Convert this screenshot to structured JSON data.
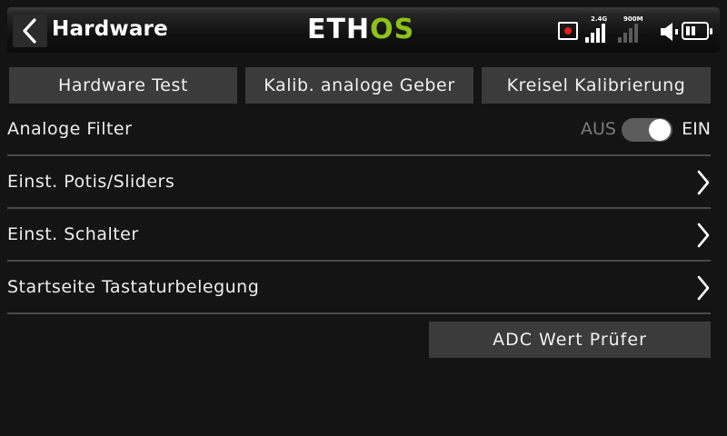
{
  "header": {
    "title": "Hardware",
    "logo": {
      "part1": "ETH",
      "part2": "OS"
    },
    "status": {
      "signal_a_label": "2.4G",
      "signal_b_label": "900M",
      "icons": [
        "record-icon",
        "signal-2-4g-icon",
        "signal-900m-icon",
        "speaker-icon",
        "battery-icon"
      ]
    }
  },
  "top_buttons": {
    "hardware_test": "Hardware Test",
    "calib_analog": "Kalib. analoge Geber",
    "gyro_calib": "Kreisel Kalibrierung"
  },
  "settings": {
    "analog_filter": {
      "label": "Analoge Filter",
      "off_label": "AUS",
      "on_label": "EIN",
      "value": "EIN"
    },
    "pots_sliders": "Einst. Potis/Sliders",
    "switches": "Einst. Schalter",
    "home_key_mapping": "Startseite Tastaturbelegung"
  },
  "adc_button": "ADC Wert Prüfer",
  "colors": {
    "background": "#141414",
    "button": "#3b3b3b",
    "accent_green": "#8cc21a",
    "record_red": "#e0201c"
  }
}
